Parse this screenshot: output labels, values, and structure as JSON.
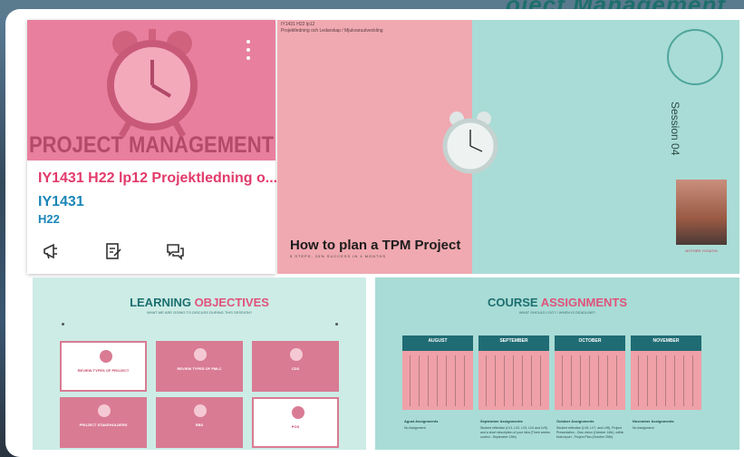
{
  "header": {
    "title": "oject Management"
  },
  "course_card": {
    "banner_title": "PROJECT MANAGEMENT",
    "name": "IY1431 H22 lp12 Projektledning o...",
    "code": "IY1431",
    "term": "H22",
    "icons": [
      "announcements-icon",
      "assignments-icon",
      "discussions-icon"
    ]
  },
  "hero_slide": {
    "small_code": "IY1431 H22 lp12",
    "small_subtitle": "Projektledning och Ledarskap / Mjukvaruutveckling",
    "title": "How to plan a TPM Project",
    "subtitle": "5 STEPS, 33% SUCCESS IN 4 MONTHS",
    "session": "Session 04",
    "presenter": "NOTHER YOSATHI"
  },
  "learning_objectives": {
    "heading_main": "LEARNING ",
    "heading_accent": "OBJECTIVES",
    "tagline": "WHAT WE ARE GOING TO DISCUSS DURING THIS SESSION?",
    "boxes": [
      {
        "title": "REVIEW TYPES OF PROJECT"
      },
      {
        "title": "REVIEW TYPES OF PMLC"
      },
      {
        "title": "CDS"
      },
      {
        "title": "PROJECT STAKEHOLDERS"
      },
      {
        "title": "RBS"
      },
      {
        "title": "POS"
      }
    ]
  },
  "course_assignments": {
    "heading_main": "COURSE ",
    "heading_accent": "ASSIGNMENTS",
    "tagline": "WHAT SHOULD I DO? / WHEN IS DEADLINE?",
    "months": [
      "AUGUST",
      "SEPTEMBER",
      "OCTOBER",
      "NOVEMBER"
    ],
    "assignments": [
      {
        "title": "Agust Assignments",
        "text": "No Assignment"
      },
      {
        "title": "September Assignments",
        "text": "Student reflection (LV1, LV2, LV3, LV4 and LV5) and a short description of your idea (Three weeks control - September 15th)"
      },
      {
        "title": "October Assignments",
        "text": "Student reflection (LV6, LV7, and LV8), Project Presentation - Own vision (October 14th), within final report - Project Plan (October 25th)"
      },
      {
        "title": "November Assignments",
        "text": "No Assignment"
      }
    ]
  }
}
